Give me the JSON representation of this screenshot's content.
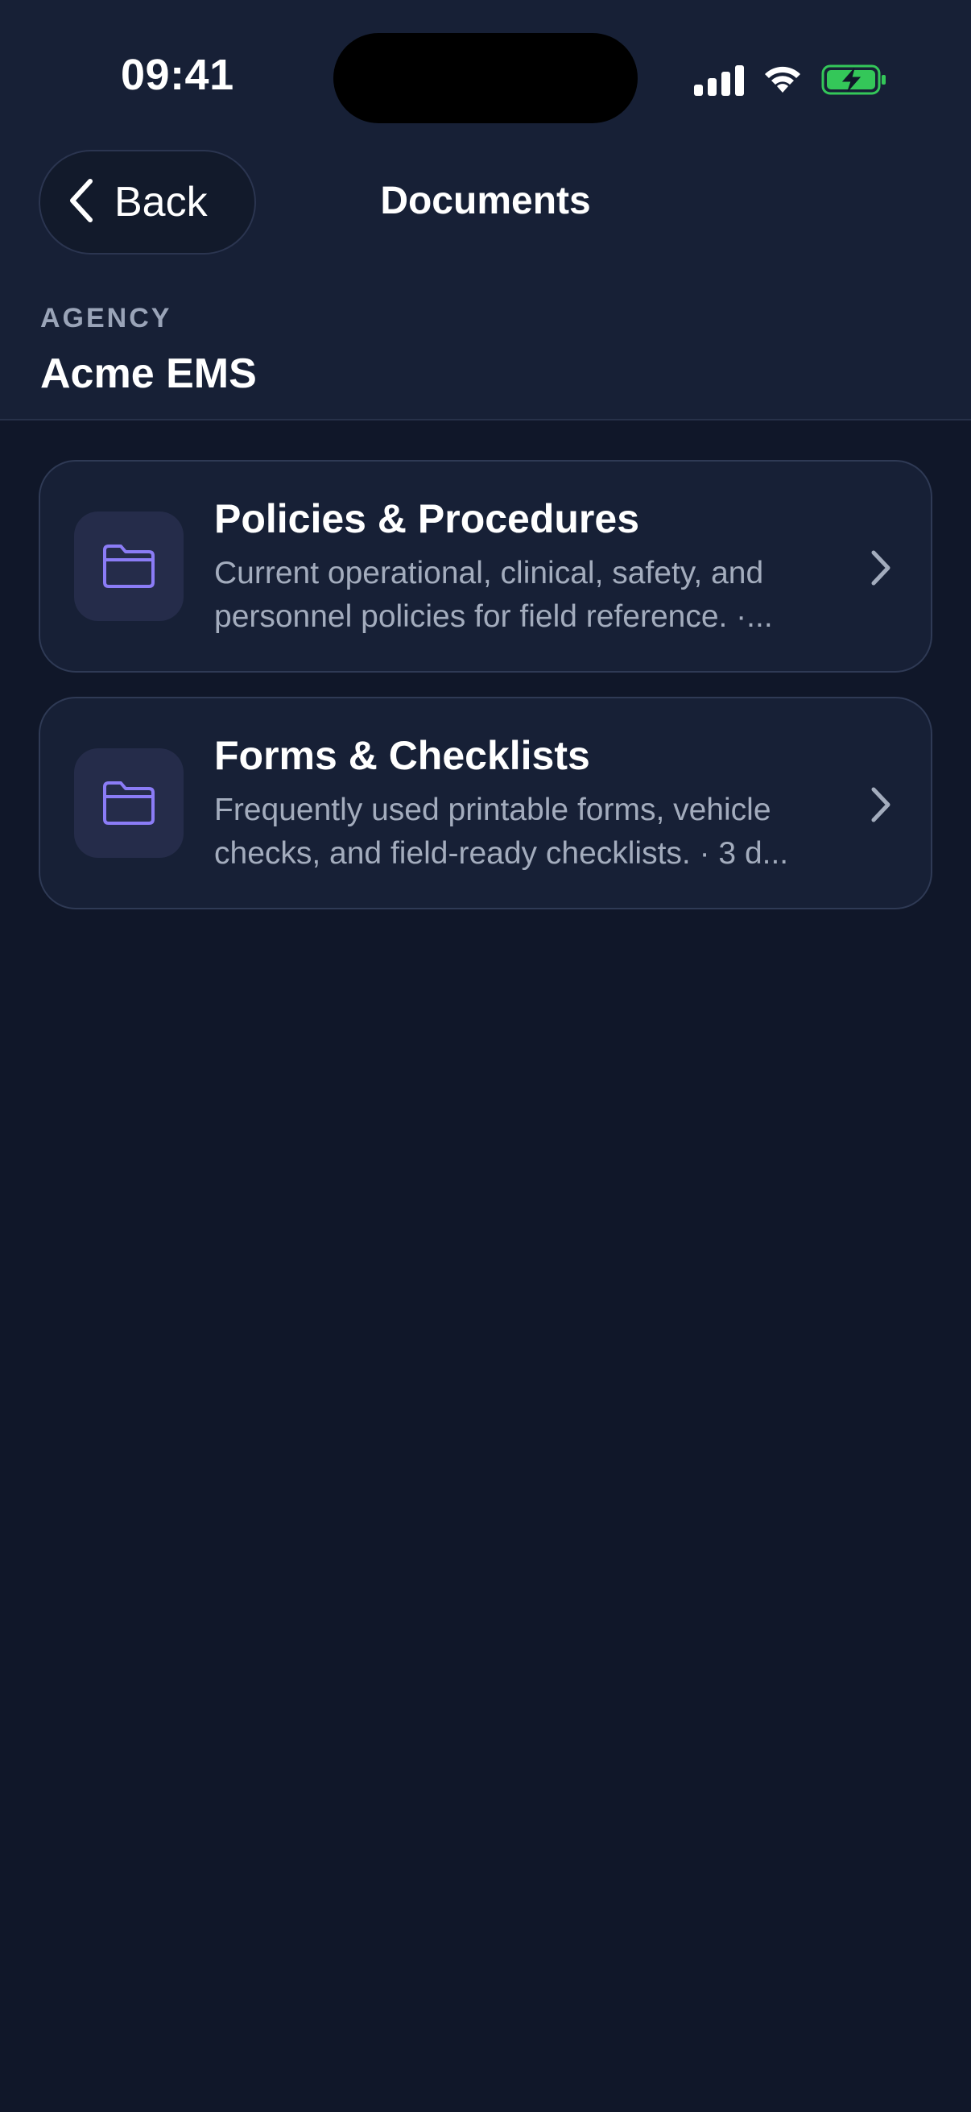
{
  "status_bar": {
    "time": "09:41",
    "icons": [
      "cellular-signal-icon",
      "wifi-icon",
      "battery-charging-icon"
    ],
    "battery_color": "#34c759"
  },
  "nav": {
    "back_label": "Back",
    "title": "Documents"
  },
  "agency": {
    "label": "AGENCY",
    "name": "Acme EMS"
  },
  "folders": [
    {
      "title": "Policies & Procedures",
      "description_line1": "Current operational, clinical, safety, and",
      "description_line2": "personnel policies for field reference. ·...",
      "icon": "folder-icon"
    },
    {
      "title": "Forms & Checklists",
      "description_line1": "Frequently used printable forms, vehicle",
      "description_line2": "checks, and field-ready checklists. · 3 d...",
      "icon": "folder-icon"
    }
  ],
  "colors": {
    "background": "#101729",
    "header": "#172036",
    "accent_folder": "#8b7cf6",
    "text_secondary": "#a3acbd"
  }
}
